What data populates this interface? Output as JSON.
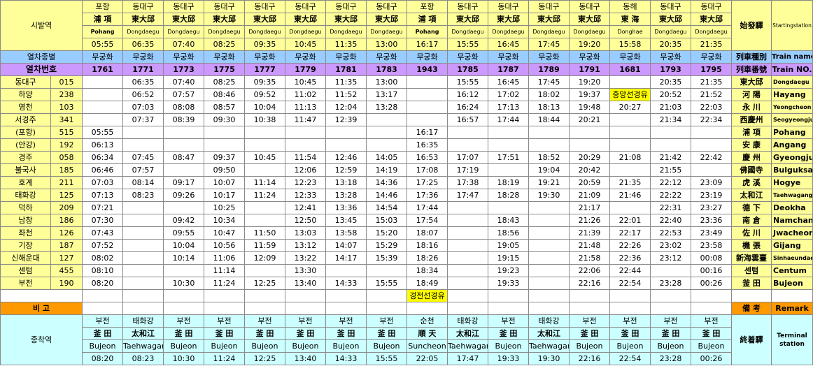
{
  "labels": {
    "start_station": "시발역",
    "start_station_hanja": "始發驛",
    "start_station_en": "Startingstation",
    "train_type": "열차종별",
    "train_type_hanja": "列車種別",
    "train_type_en": "Train name",
    "train_no": "열차번호",
    "train_no_hanja": "列車番號",
    "train_no_en": "Train NO.",
    "remarks": "비 고",
    "remarks_hanja": "備 考",
    "remarks_en": "Remark",
    "terminal": "종착역",
    "terminal_hanja": "終着驛",
    "terminal_en": "Terminal station"
  },
  "origins": [
    {
      "ko": "포항",
      "hanja": "浦 項",
      "en": "Pohang",
      "time": "05:55"
    },
    {
      "ko": "동대구",
      "hanja": "東大邱",
      "en": "Dongdaegu",
      "time": "06:35"
    },
    {
      "ko": "동대구",
      "hanja": "東大邱",
      "en": "Dongdaegu",
      "time": "07:40"
    },
    {
      "ko": "동대구",
      "hanja": "東大邱",
      "en": "Dongdaegu",
      "time": "08:25"
    },
    {
      "ko": "동대구",
      "hanja": "東大邱",
      "en": "Dongdaegu",
      "time": "09:35"
    },
    {
      "ko": "동대구",
      "hanja": "東大邱",
      "en": "Dongdaegu",
      "time": "10:45"
    },
    {
      "ko": "동대구",
      "hanja": "東大邱",
      "en": "Dongdaegu",
      "time": "11:35"
    },
    {
      "ko": "동대구",
      "hanja": "東大邱",
      "en": "Dongdaegu",
      "time": "13:00"
    },
    {
      "ko": "포항",
      "hanja": "浦 項",
      "en": "Pohang",
      "time": "16:17"
    },
    {
      "ko": "동대구",
      "hanja": "東大邱",
      "en": "Dongdaegu",
      "time": "15:55"
    },
    {
      "ko": "동대구",
      "hanja": "東大邱",
      "en": "Dongdaegu",
      "time": "16:45"
    },
    {
      "ko": "동대구",
      "hanja": "東大邱",
      "en": "Dongdaegu",
      "time": "17:45"
    },
    {
      "ko": "동대구",
      "hanja": "東大邱",
      "en": "Dongdaegu",
      "time": "19:20"
    },
    {
      "ko": "동해",
      "hanja": "東 海",
      "en": "Donghae",
      "time": "15:58"
    },
    {
      "ko": "동대구",
      "hanja": "東大邱",
      "en": "Dongdaegu",
      "time": "20:35"
    },
    {
      "ko": "동대구",
      "hanja": "東大邱",
      "en": "Dongdaegu",
      "time": "21:35"
    }
  ],
  "train_types": [
    "무궁화",
    "무궁화",
    "무궁화",
    "무궁화",
    "무궁화",
    "무궁화",
    "무궁화",
    "무궁화",
    "무궁화",
    "무궁화",
    "무궁화",
    "무궁화",
    "무궁화",
    "무궁화",
    "무궁화",
    "무궁화"
  ],
  "train_numbers": [
    "1761",
    "1771",
    "1773",
    "1775",
    "1777",
    "1779",
    "1781",
    "1783",
    "1943",
    "1785",
    "1787",
    "1789",
    "1791",
    "1681",
    "1793",
    "1795"
  ],
  "stations": [
    {
      "ko": "동대구",
      "code": "015",
      "hanja": "東大邱",
      "en": "Dongdaegu",
      "small": true,
      "times": [
        "",
        "06:35",
        "07:40",
        "08:25",
        "09:35",
        "10:45",
        "11:35",
        "13:00",
        "",
        "15:55",
        "16:45",
        "17:45",
        "19:20",
        "",
        "20:35",
        "21:35"
      ]
    },
    {
      "ko": "하양",
      "code": "238",
      "hanja": "河 陽",
      "en": "Hayang",
      "small": false,
      "times": [
        "",
        "06:52",
        "07:57",
        "08:46",
        "09:52",
        "11:02",
        "11:52",
        "13:17",
        "",
        "16:12",
        "17:02",
        "18:02",
        "19:37",
        "중앙선경유",
        "20:52",
        "21:52"
      ]
    },
    {
      "ko": "영천",
      "code": "103",
      "hanja": "永 川",
      "en": "Yeongcheon",
      "small": true,
      "times": [
        "",
        "07:03",
        "08:08",
        "08:57",
        "10:04",
        "11:13",
        "12:04",
        "13:28",
        "",
        "16:24",
        "17:13",
        "18:13",
        "19:48",
        "20:27",
        "21:03",
        "22:03"
      ]
    },
    {
      "ko": "서경주",
      "code": "341",
      "hanja": "西慶州",
      "en": "Seogyeongju",
      "small": true,
      "times": [
        "",
        "07:37",
        "08:39",
        "09:30",
        "10:38",
        "11:47",
        "12:39",
        "",
        "",
        "16:57",
        "17:44",
        "18:44",
        "20:21",
        "",
        "21:34",
        "22:34"
      ]
    },
    {
      "ko": "(포항)",
      "code": "515",
      "hanja": "浦 項",
      "en": "Pohang",
      "small": false,
      "times": [
        "05:55",
        "",
        "",
        "",
        "",
        "",
        "",
        "",
        "16:17",
        "",
        "",
        "",
        "",
        "",
        "",
        ""
      ]
    },
    {
      "ko": "(안강)",
      "code": "192",
      "hanja": "安 康",
      "en": "Angang",
      "small": false,
      "times": [
        "06:13",
        "",
        "",
        "",
        "",
        "",
        "",
        "",
        "16:35",
        "",
        "",
        "",
        "",
        "",
        "",
        ""
      ]
    },
    {
      "ko": "경주",
      "code": "058",
      "hanja": "慶 州",
      "en": "Gyeongju",
      "small": false,
      "times": [
        "06:34",
        "07:45",
        "08:47",
        "09:37",
        "10:45",
        "11:54",
        "12:46",
        "14:05",
        "16:53",
        "17:07",
        "17:51",
        "18:52",
        "20:29",
        "21:08",
        "21:42",
        "22:42"
      ]
    },
    {
      "ko": "불국사",
      "code": "185",
      "hanja": "佛國寺",
      "en": "Bulguksa",
      "small": false,
      "times": [
        "06:46",
        "07:57",
        "",
        "09:50",
        "",
        "12:06",
        "12:59",
        "14:19",
        "17:08",
        "17:19",
        "",
        "19:04",
        "20:42",
        "",
        "21:55",
        ""
      ]
    },
    {
      "ko": "호계",
      "code": "211",
      "hanja": "虎 溪",
      "en": "Hogye",
      "small": false,
      "times": [
        "07:03",
        "08:14",
        "09:17",
        "10:07",
        "11:14",
        "12:23",
        "13:18",
        "14:36",
        "17:25",
        "17:38",
        "18:19",
        "19:21",
        "20:59",
        "21:35",
        "22:12",
        "23:09"
      ]
    },
    {
      "ko": "태화강",
      "code": "125",
      "hanja": "太和江",
      "en": "Taehwagang",
      "small": true,
      "times": [
        "07:13",
        "08:23",
        "09:26",
        "10:17",
        "11:24",
        "12:33",
        "13:28",
        "14:46",
        "17:36",
        "17:47",
        "18:28",
        "19:30",
        "21:09",
        "21:46",
        "22:22",
        "23:19"
      ]
    },
    {
      "ko": "덕하",
      "code": "209",
      "hanja": "德 下",
      "en": "Deokha",
      "small": false,
      "times": [
        "07:21",
        "",
        "",
        "10:25",
        "",
        "12:41",
        "13:36",
        "14:54",
        "17:44",
        "",
        "",
        "",
        "21:17",
        "",
        "22:31",
        "23:27"
      ]
    },
    {
      "ko": "남창",
      "code": "186",
      "hanja": "南 倉",
      "en": "Namchang",
      "small": false,
      "times": [
        "07:30",
        "",
        "09:42",
        "10:34",
        "",
        "12:50",
        "13:45",
        "15:03",
        "17:54",
        "",
        "18:43",
        "",
        "21:26",
        "22:01",
        "22:40",
        "23:36"
      ]
    },
    {
      "ko": "좌천",
      "code": "126",
      "hanja": "佐 川",
      "en": "Jwacheon",
      "small": false,
      "times": [
        "07:43",
        "",
        "09:55",
        "10:47",
        "11:50",
        "13:03",
        "13:58",
        "15:20",
        "18:07",
        "",
        "18:56",
        "",
        "21:39",
        "22:17",
        "22:53",
        "23:49"
      ]
    },
    {
      "ko": "기장",
      "code": "187",
      "hanja": "機 張",
      "en": "Gijang",
      "small": false,
      "times": [
        "07:52",
        "",
        "10:04",
        "10:56",
        "11:59",
        "13:12",
        "14:07",
        "15:29",
        "18:16",
        "",
        "19:05",
        "",
        "21:48",
        "22:26",
        "23:02",
        "23:58"
      ]
    },
    {
      "ko": "신해운대",
      "code": "127",
      "hanja": "新海雲臺",
      "en": "Sinhaeundae",
      "small": true,
      "times": [
        "08:02",
        "",
        "10:14",
        "11:06",
        "12:09",
        "13:22",
        "14:17",
        "15:39",
        "18:26",
        "",
        "19:15",
        "",
        "21:58",
        "22:36",
        "23:12",
        "00:08"
      ]
    },
    {
      "ko": "센텀",
      "code": "455",
      "hanja": "센텀",
      "en": "Centum",
      "small": false,
      "times": [
        "08:10",
        "",
        "",
        "11:14",
        "",
        "13:30",
        "",
        "",
        "18:34",
        "",
        "19:23",
        "",
        "22:06",
        "22:44",
        "",
        "00:16"
      ]
    },
    {
      "ko": "부전",
      "code": "190",
      "hanja": "釜 田",
      "en": "Bujeon",
      "small": false,
      "times": [
        "08:20",
        "",
        "10:30",
        "11:24",
        "12:25",
        "13:40",
        "14:33",
        "15:55",
        "18:49",
        "",
        "19:33",
        "",
        "22:16",
        "22:54",
        "23:28",
        "00:26"
      ]
    }
  ],
  "note_row": [
    "",
    "",
    "",
    "",
    "",
    "",
    "",
    "",
    "경전선경유",
    "",
    "",
    "",
    "",
    "",
    "",
    ""
  ],
  "destinations": [
    {
      "ko": "부전",
      "hanja": "釜 田",
      "en": "Bujeon",
      "time": "08:20"
    },
    {
      "ko": "태화강",
      "hanja": "太和江",
      "en": "Taehwagang",
      "time": "08:23"
    },
    {
      "ko": "부전",
      "hanja": "釜 田",
      "en": "Bujeon",
      "time": "10:30"
    },
    {
      "ko": "부전",
      "hanja": "釜 田",
      "en": "Bujeon",
      "time": "11:24"
    },
    {
      "ko": "부전",
      "hanja": "釜 田",
      "en": "Bujeon",
      "time": "12:25"
    },
    {
      "ko": "부전",
      "hanja": "釜 田",
      "en": "Bujeon",
      "time": "13:40"
    },
    {
      "ko": "부전",
      "hanja": "釜 田",
      "en": "Bujeon",
      "time": "14:33"
    },
    {
      "ko": "부전",
      "hanja": "釜 田",
      "en": "Bujeon",
      "time": "15:55"
    },
    {
      "ko": "순천",
      "hanja": "順 天",
      "en": "Suncheon",
      "time": "22:05"
    },
    {
      "ko": "태화강",
      "hanja": "太和江",
      "en": "Taehwagang",
      "time": "17:47"
    },
    {
      "ko": "부전",
      "hanja": "釜 田",
      "en": "Bujeon",
      "time": "19:33"
    },
    {
      "ko": "태화강",
      "hanja": "太和江",
      "en": "Taehwagang",
      "time": "19:30"
    },
    {
      "ko": "부전",
      "hanja": "釜 田",
      "en": "Bujeon",
      "time": "22:16"
    },
    {
      "ko": "부전",
      "hanja": "釜 田",
      "en": "Bujeon",
      "time": "22:54"
    },
    {
      "ko": "부전",
      "hanja": "釜 田",
      "en": "Bujeon",
      "time": "23:28"
    },
    {
      "ko": "부전",
      "hanja": "釜 田",
      "en": "Bujeon",
      "time": "00:26"
    }
  ],
  "colors": {
    "header_yellow": "#ffff99",
    "type_blue": "#99ccff",
    "number_purple": "#cc99ff",
    "remark_orange": "#ff9900",
    "terminal_cyan": "#ccffff",
    "note_highlight": "#ffff00"
  }
}
